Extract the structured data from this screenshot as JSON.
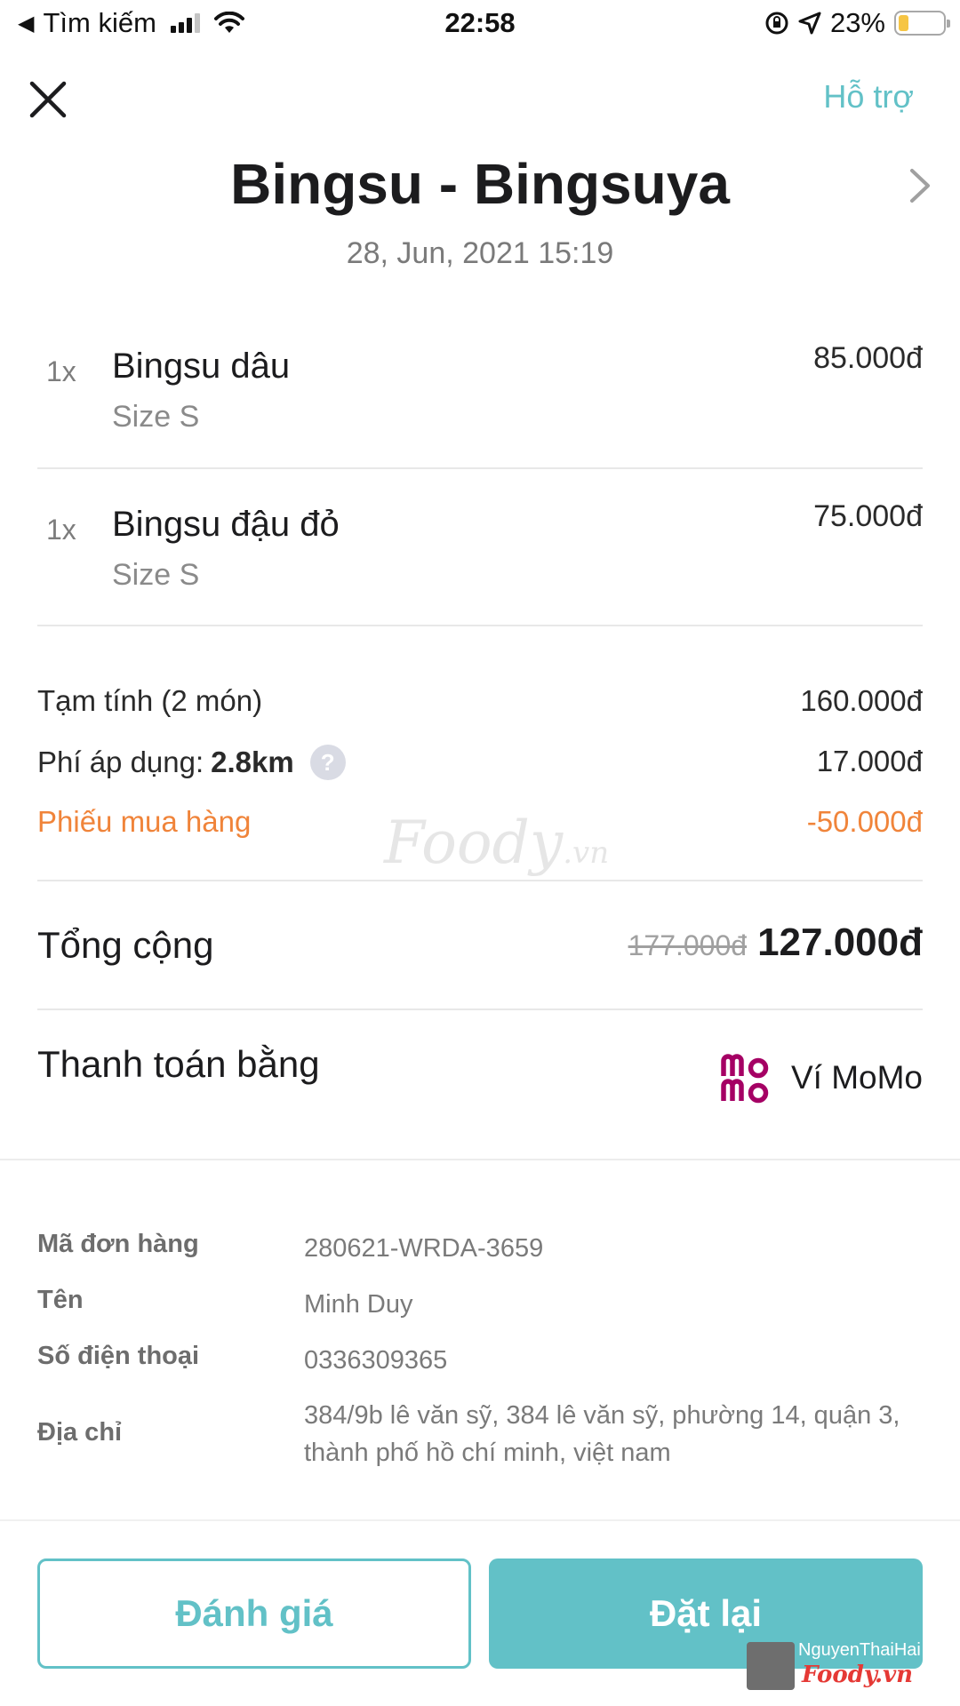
{
  "status_bar": {
    "back_label": "Tìm kiếm",
    "time": "22:58",
    "battery": "23%",
    "battery_level": 0.23
  },
  "header": {
    "support_label": "Hỗ trợ",
    "shop_name": "Bingsu - Bingsuya",
    "order_datetime": "28, Jun, 2021 15:19"
  },
  "items": [
    {
      "qty": "1x",
      "name": "Bingsu dâu",
      "option": "Size S",
      "price": "85.000đ"
    },
    {
      "qty": "1x",
      "name": "Bingsu đậu đỏ",
      "option": "Size S",
      "price": "75.000đ"
    }
  ],
  "summary": {
    "subtotal_label": "Tạm tính  (2 món)",
    "subtotal": "160.000đ",
    "fee_label": "Phí áp dụng:",
    "fee_distance": "2.8km",
    "fee": "17.000đ",
    "voucher_label": "Phiếu mua hàng",
    "voucher": "-50.000đ",
    "total_label": "Tổng cộng",
    "total_original": "177.000đ",
    "total": "127.000đ",
    "payment_label": "Thanh toán bằng",
    "payment_method": "Ví MoMo"
  },
  "watermark": {
    "brand": "Foody",
    "suffix": ".vn"
  },
  "info": {
    "order_id_label": "Mã đơn hàng",
    "order_id": "280621-WRDA-3659",
    "name_label": "Tên",
    "name": "Minh Duy",
    "phone_label": "Số điện thoại",
    "phone": "0336309365",
    "address_label": "Địa chỉ",
    "address": "384/9b lê văn sỹ, 384 lê văn sỹ, phường 14, quận 3, thành phố hồ chí minh, việt nam"
  },
  "buttons": {
    "rate": "Đánh giá",
    "reorder": "Đặt lại"
  },
  "credit": {
    "user": "NguyenThaiHai",
    "logo": "Foody.vn"
  },
  "colors": {
    "accent": "#62c1c7",
    "voucher": "#f0843a",
    "momo": "#a50064"
  }
}
